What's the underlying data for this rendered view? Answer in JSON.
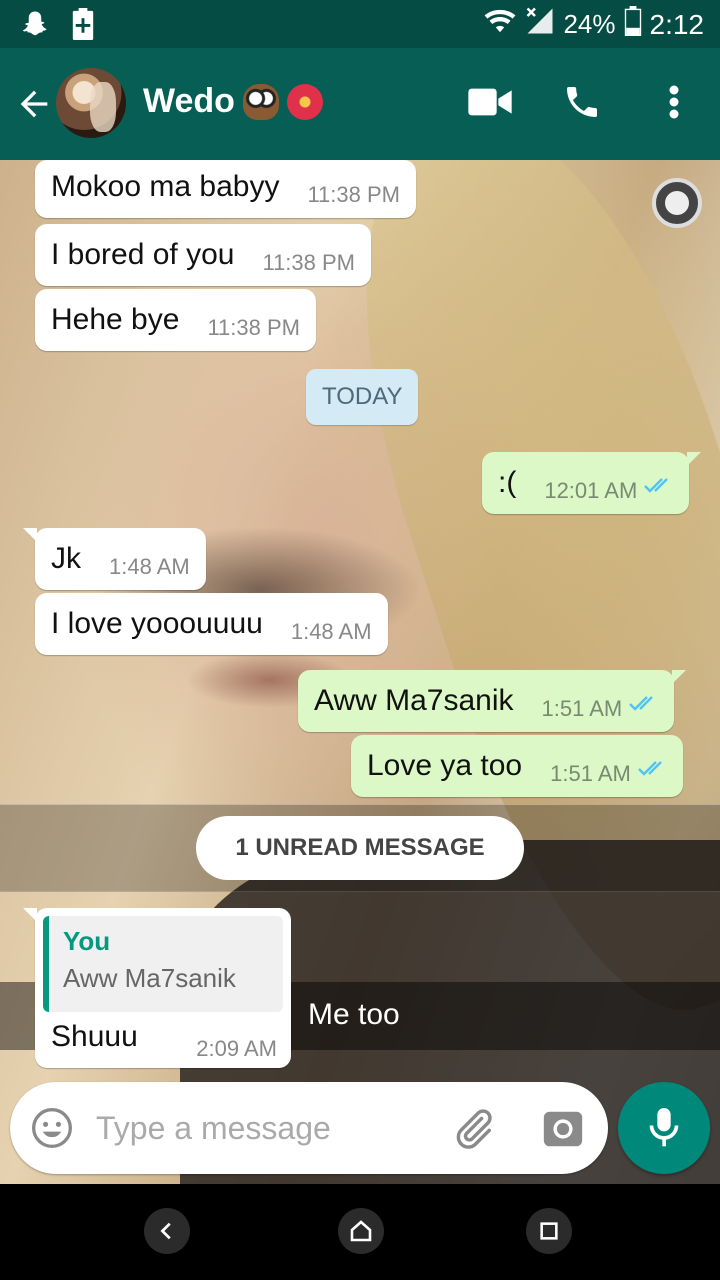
{
  "status_bar": {
    "battery": "24%",
    "time": "2:12",
    "icons": [
      "snapchat-icon",
      "battery-saver-icon",
      "wifi-icon",
      "signal-icon",
      "battery-icon"
    ]
  },
  "app_bar": {
    "contact_name": "Wedo",
    "name_emojis": [
      "owl-emoji",
      "hibiscus-emoji"
    ],
    "actions": [
      "video-call-icon",
      "phone-icon",
      "more-vert-icon"
    ]
  },
  "messages": [
    {
      "dir": "in",
      "text": "Mokoo ma babyy",
      "time": "11:38 PM"
    },
    {
      "dir": "in",
      "text": "I bored of you",
      "time": "11:38 PM"
    },
    {
      "dir": "in",
      "text": "Hehe bye",
      "time": "11:38 PM"
    },
    {
      "dir": "out",
      "text": ":(",
      "time": "12:01 AM",
      "status": "read"
    },
    {
      "dir": "in",
      "text": "Jk",
      "time": "1:48 AM"
    },
    {
      "dir": "in",
      "text": "I love yooouuuu",
      "time": "1:48 AM"
    },
    {
      "dir": "out",
      "text": "Aww Ma7sanik",
      "time": "1:51 AM",
      "status": "read"
    },
    {
      "dir": "out",
      "text": "Love ya too",
      "time": "1:51 AM",
      "status": "read"
    }
  ],
  "date_divider": "TODAY",
  "unread_label": "1 UNREAD MESSAGE",
  "reply_message": {
    "quote_author": "You",
    "quote_text": "Aww Ma7sanik",
    "text": "Shuuu",
    "time": "2:09 AM"
  },
  "wallpaper_caption": "Me too",
  "composer": {
    "placeholder": "Type a message"
  },
  "colors": {
    "header": "#075e54",
    "status_bar": "#054d44",
    "outgoing_bubble": "#dcf8c6",
    "incoming_bubble": "#ffffff",
    "accent": "#00897b",
    "read_tick": "#4fc3f7"
  }
}
